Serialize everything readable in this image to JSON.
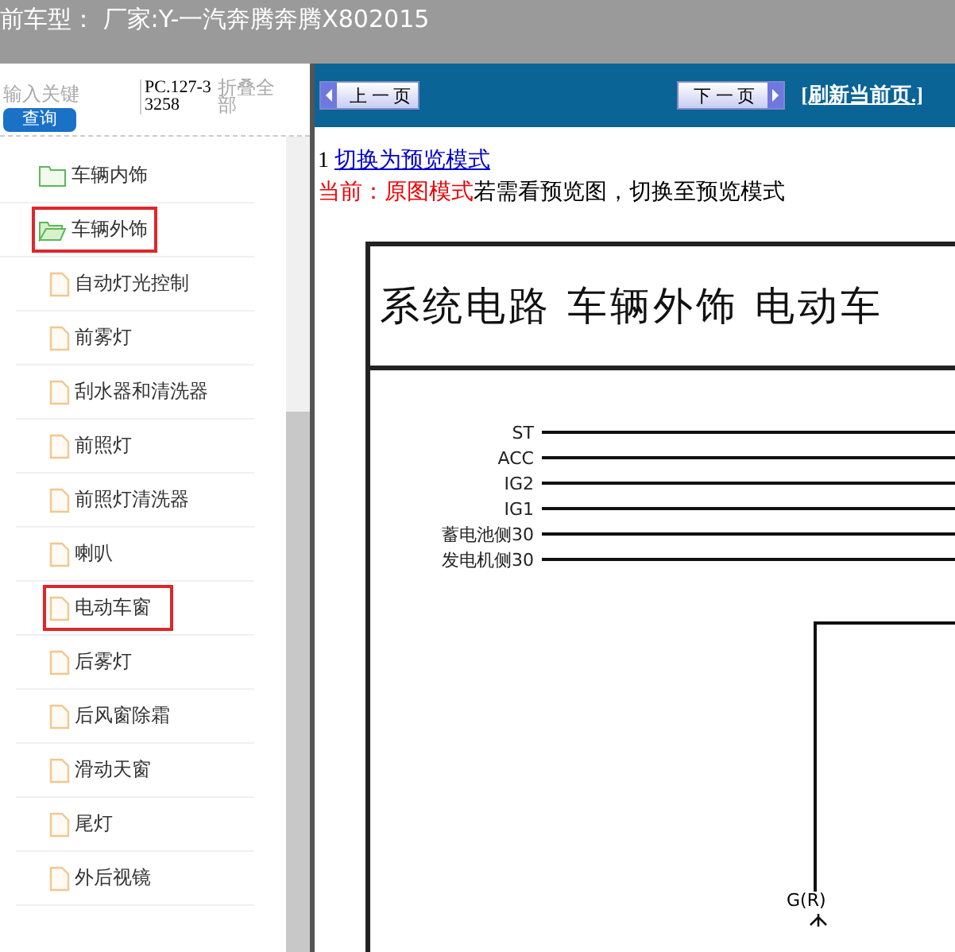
{
  "title_bar": {
    "text": "前车型： 厂家:Y-一汽奔腾奔腾X802015"
  },
  "sidebar": {
    "search": {
      "placeholder": "输入关键"
    },
    "query_button": "查询",
    "code": "PC.127-33258",
    "collapse_link": "折叠全部",
    "tree": [
      {
        "label": "车辆内饰",
        "kind": "folder",
        "expanded": false,
        "highlighted": false
      },
      {
        "label": "车辆外饰",
        "kind": "folder",
        "expanded": true,
        "highlighted": true,
        "children": [
          {
            "label": "自动灯光控制",
            "kind": "file",
            "highlighted": false
          },
          {
            "label": "前雾灯",
            "kind": "file",
            "highlighted": false
          },
          {
            "label": "刮水器和清洗器",
            "kind": "file",
            "highlighted": false
          },
          {
            "label": "前照灯",
            "kind": "file",
            "highlighted": false
          },
          {
            "label": "前照灯清洗器",
            "kind": "file",
            "highlighted": false
          },
          {
            "label": "喇叭",
            "kind": "file",
            "highlighted": false
          },
          {
            "label": "电动车窗",
            "kind": "file",
            "highlighted": true
          },
          {
            "label": "后雾灯",
            "kind": "file",
            "highlighted": false
          },
          {
            "label": "后风窗除霜",
            "kind": "file",
            "highlighted": false
          },
          {
            "label": "滑动天窗",
            "kind": "file",
            "highlighted": false
          },
          {
            "label": "尾灯",
            "kind": "file",
            "highlighted": false
          },
          {
            "label": "外后视镜",
            "kind": "file",
            "highlighted": false
          }
        ]
      }
    ]
  },
  "toolbar": {
    "prev_button": "上 一 页",
    "next_button": "下 一 页",
    "refresh_link": "[刷新当前页.]"
  },
  "mode": {
    "number": "1",
    "switch_link": "切换为预览模式",
    "current": "当前：原图模式",
    "hint": "若需看预览图，切换至预览模式"
  },
  "diagram": {
    "title": "系统电路 车辆外饰 电动车",
    "rails": [
      "ST",
      "ACC",
      "IG2",
      "IG1",
      "蓄电池侧30",
      "发电机侧30"
    ],
    "wire_label": "G(R)"
  }
}
